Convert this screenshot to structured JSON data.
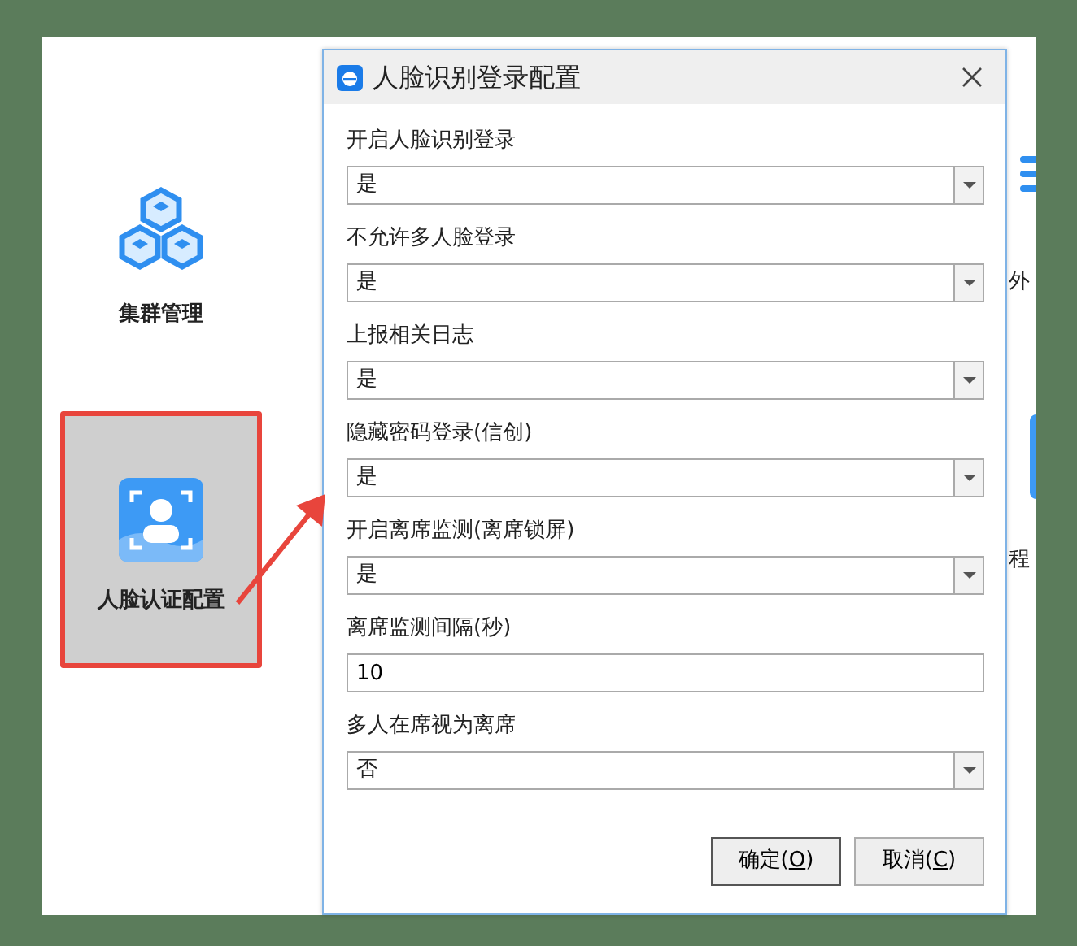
{
  "app": {
    "tiles": [
      {
        "label": "集群管理",
        "selected": false
      },
      {
        "label": "人脸认证配置",
        "selected": true
      }
    ],
    "partial_tiles": [
      {
        "label": "外"
      },
      {
        "label": "程"
      }
    ]
  },
  "dialog": {
    "title": "人脸识别登录配置",
    "fields": [
      {
        "label": "开启人脸识别登录",
        "kind": "select",
        "value": "是"
      },
      {
        "label": "不允许多人脸登录",
        "kind": "select",
        "value": "是"
      },
      {
        "label": "上报相关日志",
        "kind": "select",
        "value": "是"
      },
      {
        "label": "隐藏密码登录(信创)",
        "kind": "select",
        "value": "是"
      },
      {
        "label": "开启离席监测(离席锁屏)",
        "kind": "select",
        "value": "是"
      },
      {
        "label": "离席监测间隔(秒)",
        "kind": "input",
        "value": "10"
      },
      {
        "label": "多人在席视为离席",
        "kind": "select",
        "value": "否"
      }
    ],
    "buttons": [
      {
        "label": "确定(O)",
        "default": true
      },
      {
        "label": "取消(C)",
        "default": false
      }
    ]
  },
  "annotation": {
    "kind": "arrow"
  }
}
